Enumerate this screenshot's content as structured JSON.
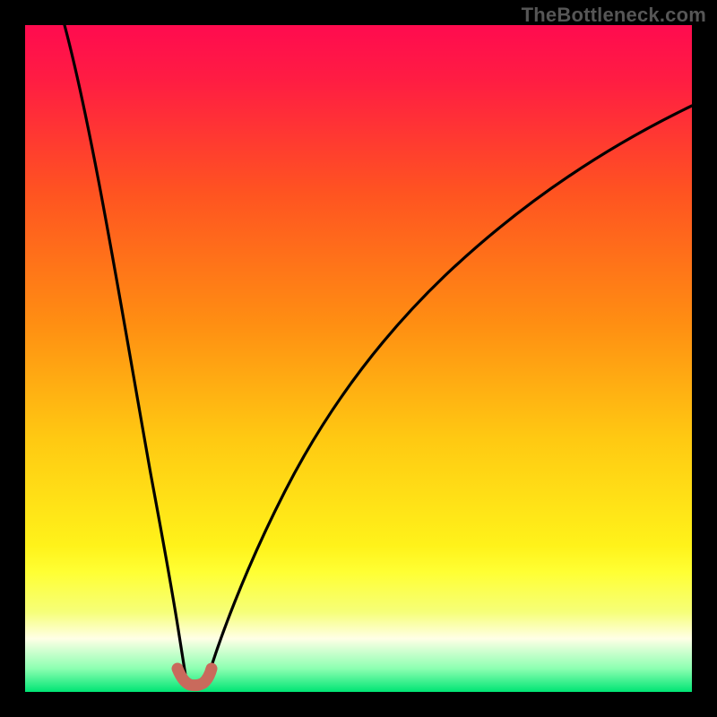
{
  "watermark": "TheBottleneck.com",
  "chart_data": {
    "type": "line",
    "title": "",
    "xlabel": "",
    "ylabel": "",
    "xlim": [
      0,
      100
    ],
    "ylim": [
      0,
      100
    ],
    "grid": false,
    "legend": false,
    "_note": "No axis ticks or labels are rendered. Values below are estimated relative coordinates in percent of plot area (x,y with 0,0 at bottom-left).",
    "gradient_stops": [
      {
        "offset": 0.0,
        "color": "#ff0b4f"
      },
      {
        "offset": 0.08,
        "color": "#ff1c43"
      },
      {
        "offset": 0.25,
        "color": "#ff5321"
      },
      {
        "offset": 0.45,
        "color": "#ff8f12"
      },
      {
        "offset": 0.62,
        "color": "#ffc912"
      },
      {
        "offset": 0.78,
        "color": "#fff21a"
      },
      {
        "offset": 0.82,
        "color": "#ffff33"
      },
      {
        "offset": 0.88,
        "color": "#f6ff78"
      },
      {
        "offset": 0.92,
        "color": "#ffffe6"
      },
      {
        "offset": 0.965,
        "color": "#8cffb1"
      },
      {
        "offset": 1.0,
        "color": "#00e574"
      }
    ],
    "series": [
      {
        "name": "left-branch",
        "color": "#000000",
        "x": [
          6,
          8,
          10,
          12,
          14,
          16,
          18,
          19,
          20,
          21,
          22,
          23,
          23.5
        ],
        "y": [
          100,
          90,
          79,
          68,
          56,
          43,
          30,
          23,
          17,
          11,
          6,
          2.5,
          1.2
        ]
      },
      {
        "name": "right-branch",
        "color": "#000000",
        "x": [
          27,
          28,
          30,
          32,
          35,
          40,
          45,
          50,
          56,
          63,
          71,
          80,
          90,
          98,
          100
        ],
        "y": [
          1.5,
          4,
          10,
          17,
          26,
          38,
          47,
          54,
          61,
          67,
          73,
          78.5,
          83.5,
          87,
          88
        ]
      },
      {
        "name": "bottom-highlight",
        "color": "#c96a5c",
        "x": [
          22.5,
          23,
          24,
          25,
          26,
          26.8,
          27.3
        ],
        "y": [
          3.3,
          1.7,
          0.9,
          0.8,
          0.9,
          1.7,
          3.2
        ]
      }
    ]
  }
}
